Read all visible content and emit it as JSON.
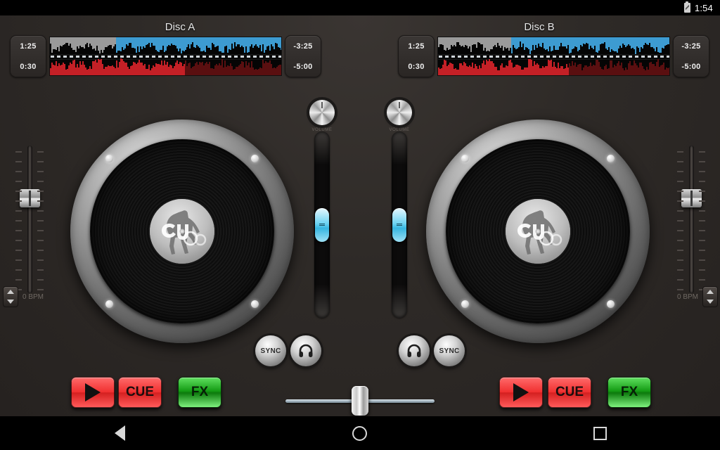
{
  "status_bar": {
    "clock": "1:54",
    "battery_icon": "battery-icon"
  },
  "decks": [
    {
      "id": "a",
      "title": "Disc A",
      "elapsed_top": "1:25",
      "elapsed_bottom": "0:30",
      "remaining_top": "-3:25",
      "remaining_bottom": "-5:00",
      "bpm": "0 BPM",
      "knob_label": "VOLUME",
      "sync_label": "SYNC",
      "cue_monitor_icon": "headphones-icon",
      "play_label": "",
      "cue_label": "CUE",
      "fx_label": "FX",
      "play_icon": "play-icon",
      "waveform": {
        "top_color": "#3d9bd1",
        "top_played_color": "#9a9a9a",
        "bottom_color": "#5a0f10",
        "bottom_played_color": "#c42026",
        "top_playhead_pct": 28,
        "bottom_playhead_pct": 58
      },
      "channel_fader_pct": 50,
      "pitch_fader_pct": 30
    },
    {
      "id": "b",
      "title": "Disc B",
      "elapsed_top": "1:25",
      "elapsed_bottom": "0:30",
      "remaining_top": "-3:25",
      "remaining_bottom": "-5:00",
      "bpm": "0 BPM",
      "knob_label": "VOLUME",
      "sync_label": "SYNC",
      "cue_monitor_icon": "headphones-icon",
      "play_label": "",
      "cue_label": "CUE",
      "fx_label": "FX",
      "play_icon": "play-icon",
      "waveform": {
        "top_color": "#3d9bd1",
        "top_played_color": "#9a9a9a",
        "bottom_color": "#5a0f10",
        "bottom_played_color": "#c42026",
        "top_playhead_pct": 31,
        "bottom_playhead_pct": 56
      },
      "channel_fader_pct": 50,
      "pitch_fader_pct": 30
    }
  ],
  "crossfader": {
    "position_pct": 50
  },
  "nav_bar": {
    "back_icon": "back-triangle-icon",
    "home_icon": "home-circle-icon",
    "recents_icon": "recents-square-icon"
  },
  "colors": {
    "accent_cyan": "#6fd4f2",
    "play_red": "#f02f2f",
    "fx_green": "#159c15",
    "panel_bg": "#2e2a27"
  }
}
